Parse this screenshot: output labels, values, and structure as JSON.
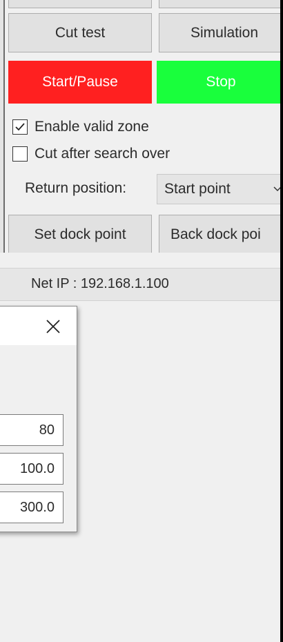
{
  "buttons": {
    "cut_test": "Cut test",
    "simulation": "Simulation",
    "start_pause": "Start/Pause",
    "stop": "Stop",
    "set_dock_point": "Set dock point",
    "back_dock_point": "Back dock poi"
  },
  "options": {
    "enable_valid_zone": {
      "label": "Enable valid zone",
      "checked": true
    },
    "cut_after_search_over": {
      "label": "Cut after search over",
      "checked": false
    }
  },
  "return_position": {
    "label": "Return position:",
    "selected": "Start point"
  },
  "status": {
    "net_ip": "Net IP : 192.168.1.100"
  },
  "dialog": {
    "fields": [
      "80",
      "100.0",
      "300.0"
    ]
  },
  "colors": {
    "start_pause_bg": "#ff2020",
    "stop_bg": "#19ff3c",
    "window_bg": "#f0f0f0"
  }
}
